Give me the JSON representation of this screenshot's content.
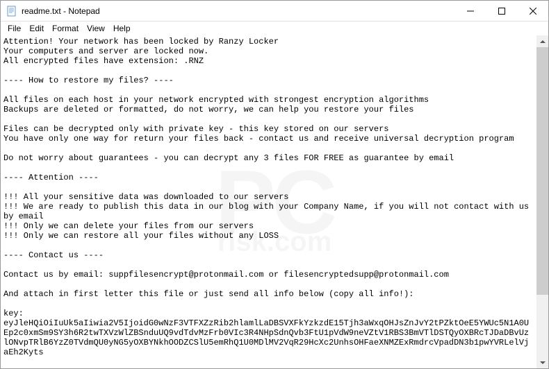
{
  "window": {
    "title": "readme.txt - Notepad"
  },
  "menubar": {
    "file": "File",
    "edit": "Edit",
    "format": "Format",
    "view": "View",
    "help": "Help"
  },
  "content": "Attention! Your network has been locked by Ranzy Locker\nYour computers and server are locked now.\nAll encrypted files have extension: .RNZ\n\n---- How to restore my files? ----\n\nAll files on each host in your network encrypted with strongest encryption algorithms\nBackups are deleted or formatted, do not worry, we can help you restore your files\n\nFiles can be decrypted only with private key - this key stored on our servers\nYou have only one way for return your files back - contact us and receive universal decryption program\n\nDo not worry about guarantees - you can decrypt any 3 files FOR FREE as guarantee by email\n\n---- Attention ----\n\n!!! All your sensitive data was downloaded to our servers\n!!! We are ready to publish this data in our blog with your Company Name, if you will not contact with us by email\n!!! Only we can delete your files from our servers\n!!! Only we can restore all your files without any LOSS\n\n---- Contact us ----\n\nContact us by email: suppfilesencrypt@protonmail.com or filesencryptedsupp@protonmail.com\n\nAnd attach in first letter this file or just send all info below (copy all info!):\n\nkey:\neyJleHQiOiIuUk5aIiwia2V5IjoidG0wNzF3VTFXZzRib2hlamlLaDBSVXFkYzkzdE15Tjh3aWxqOHJsZnJvY2tPZktOeE5YWUc5N1A0UEp2c0xmSm9SY3h6R2twTXVzWlZBSnduUQ9vdTdvMzFrb0VIc3R4NHpSdnQvb3FtU1pVdW9neVZtV1RBS3BmVTlDSTQyOXBRcTJDaDBvUzlONvpTRlB6YzZ0TVdmQU0yNG5yOXBYNkhOODZCSlU5emRhQ1U0MDlMV2VqR29HcXc2UnhsOHFaeXNMZExRmdrcVpadDN3b1pwYVRLelVjaEh2Kyts"
}
